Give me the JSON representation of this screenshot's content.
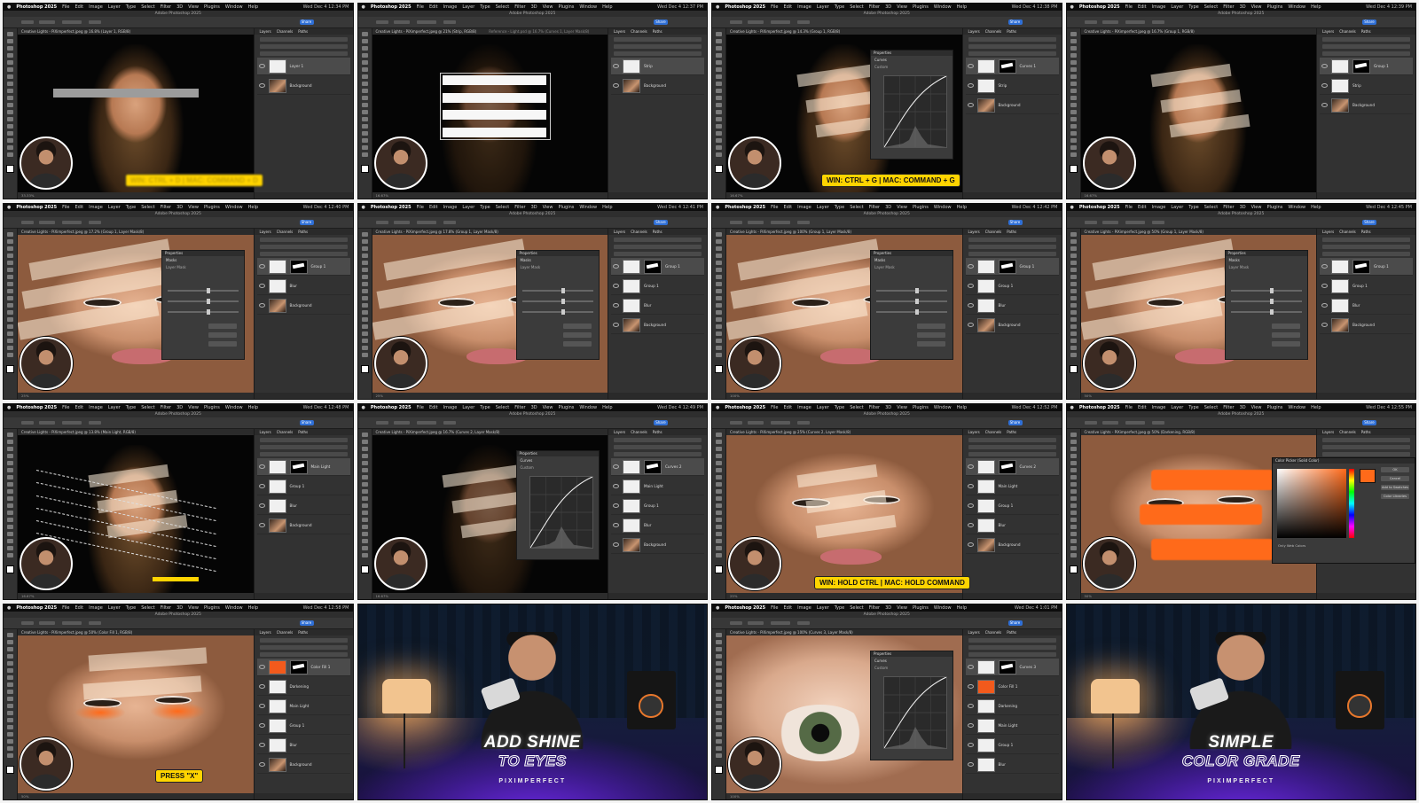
{
  "app": {
    "name": "Photoshop 2025",
    "window_title": "Adobe Photoshop 2025",
    "menus": [
      "File",
      "Edit",
      "Image",
      "Layer",
      "Type",
      "Select",
      "Filter",
      "3D",
      "View",
      "Plugins",
      "Window",
      "Help"
    ]
  },
  "frames": [
    {
      "id": "f1",
      "time": "Wed Dec 4 12:34 PM",
      "tab": "Creative Lights - PiXimperfect.jpeg @ 16.8% (Layer 1, RGB/8)",
      "scene": "stripe-single",
      "status": "33.33%",
      "layers": [
        {
          "name": "Layer 1",
          "thumb": "white",
          "sel": true
        },
        {
          "name": "Background",
          "thumb": "face"
        }
      ],
      "callout": {
        "text": "WIN: CTRL + D | MAC: COMMAND + D",
        "style": "blurred"
      }
    },
    {
      "id": "f2",
      "time": "Wed Dec 4 12:37 PM",
      "tab": "Creative Lights - PiXimperfect.jpeg @ 21% (Strip, RGB/8)",
      "tab2": "Reference - Light.psd @ 16.7% (Curves 1, Layer Mask/8)",
      "scene": "stripes-transform",
      "status": "16.67%",
      "layers": [
        {
          "name": "Strip",
          "thumb": "white",
          "sel": true
        },
        {
          "name": "Background",
          "thumb": "face"
        }
      ]
    },
    {
      "id": "f3",
      "time": "Wed Dec 4 12:38 PM",
      "tab": "Creative Lights - PiXimperfect.jpeg @ 14.3% (Group 1, RGB/8)",
      "scene": "stripes-curves",
      "status": "16.67%",
      "dialog": {
        "title": "Properties",
        "kind": "Curves",
        "preset": "Custom"
      },
      "layers": [
        {
          "name": "Curves 1",
          "thumb": "white",
          "mask": true,
          "sel": true
        },
        {
          "name": "Strip",
          "thumb": "white"
        },
        {
          "name": "Background",
          "thumb": "face"
        }
      ],
      "callout": {
        "text": "WIN: CTRL + G | MAC: COMMAND + G",
        "style": "solid"
      }
    },
    {
      "id": "f4",
      "time": "Wed Dec 4 12:39 PM",
      "tab": "Creative Lights - PiXimperfect.jpeg @ 16.7% (Group 1, RGB/8)",
      "scene": "stripes-lit",
      "status": "16.67%",
      "layers": [
        {
          "name": "Group 1",
          "thumb": "white",
          "mask": true,
          "sel": true
        },
        {
          "name": "Strip",
          "thumb": "white"
        },
        {
          "name": "Background",
          "thumb": "face"
        }
      ]
    },
    {
      "id": "f5",
      "time": "Wed Dec 4 12:40 PM",
      "tab": "Creative Lights - PiXimperfect.jpeg @ 17.2% (Group 1, Layer Mask/8)",
      "scene": "face-stripes",
      "status": "25%",
      "dialog": {
        "title": "Properties",
        "kind": "Masks",
        "preset": "Layer Mask"
      },
      "layers": [
        {
          "name": "Group 1",
          "thumb": "white",
          "mask": true,
          "sel": true
        },
        {
          "name": "Blur",
          "thumb": "white"
        },
        {
          "name": "Background",
          "thumb": "face"
        }
      ]
    },
    {
      "id": "f6",
      "time": "Wed Dec 4 12:41 PM",
      "tab": "Creative Lights - PiXimperfect.jpeg @ 17.8% (Group 1, Layer Mask/8)",
      "scene": "face-stripes",
      "status": "25%",
      "dialog": {
        "title": "Properties",
        "kind": "Masks",
        "preset": "Layer Mask"
      },
      "layers": [
        {
          "name": "Group 1",
          "thumb": "white",
          "mask": true,
          "sel": true
        },
        {
          "name": "Group 1",
          "thumb": "white"
        },
        {
          "name": "Blur",
          "thumb": "white"
        },
        {
          "name": "Background",
          "thumb": "face"
        }
      ]
    },
    {
      "id": "f7",
      "time": "Wed Dec 4 12:42 PM",
      "tab": "Creative Lights - PiXimperfect.jpeg @ 100% (Group 1, Layer Mask/8)",
      "scene": "closeup-eye",
      "status": "100%",
      "dialog": {
        "title": "Properties",
        "kind": "Masks",
        "preset": "Layer Mask"
      },
      "layers": [
        {
          "name": "Group 1",
          "thumb": "white",
          "mask": true,
          "sel": true
        },
        {
          "name": "Group 1",
          "thumb": "white"
        },
        {
          "name": "Blur",
          "thumb": "white"
        },
        {
          "name": "Background",
          "thumb": "face"
        }
      ]
    },
    {
      "id": "f8",
      "time": "Wed Dec 4 12:45 PM",
      "tab": "Creative Lights - PiXimperfect.jpeg @ 50% (Group 1, Layer Mask/8)",
      "scene": "closeup-face",
      "status": "50%",
      "dialog": {
        "title": "Properties",
        "kind": "Masks",
        "preset": "Layer Mask"
      },
      "layers": [
        {
          "name": "Group 1",
          "thumb": "white",
          "mask": true,
          "sel": true
        },
        {
          "name": "Group 1",
          "thumb": "white"
        },
        {
          "name": "Blur",
          "thumb": "white"
        },
        {
          "name": "Background",
          "thumb": "face"
        }
      ]
    },
    {
      "id": "f9",
      "time": "Wed Dec 4 12:48 PM",
      "tab": "Creative Lights - PiXimperfect.jpeg @ 13.8% (Main Light, RGB/8)",
      "scene": "stripes-selection",
      "status": "16.67%",
      "layers": [
        {
          "name": "Main Light",
          "thumb": "white",
          "mask": true,
          "sel": true
        },
        {
          "name": "Group 1",
          "thumb": "white"
        },
        {
          "name": "Blur",
          "thumb": "white"
        },
        {
          "name": "Background",
          "thumb": "face"
        }
      ],
      "bar": true
    },
    {
      "id": "f10",
      "time": "Wed Dec 4 12:49 PM",
      "tab": "Creative Lights - PiXimperfect.jpeg @ 16.7% (Curves 2, Layer Mask/8)",
      "scene": "stripes-dim-curves",
      "status": "16.67%",
      "dialog": {
        "title": "Properties",
        "kind": "Curves",
        "preset": "Custom"
      },
      "layers": [
        {
          "name": "Curves 2",
          "thumb": "white",
          "mask": true,
          "sel": true
        },
        {
          "name": "Main Light",
          "thumb": "white"
        },
        {
          "name": "Group 1",
          "thumb": "white"
        },
        {
          "name": "Blur",
          "thumb": "white"
        },
        {
          "name": "Background",
          "thumb": "face"
        }
      ]
    },
    {
      "id": "f11",
      "time": "Wed Dec 4 12:52 PM",
      "tab": "Creative Lights - PiXimperfect.jpeg @ 25% (Curves 2, Layer Mask/8)",
      "scene": "face-hair-select",
      "status": "25%",
      "layers": [
        {
          "name": "Curves 2",
          "thumb": "white",
          "mask": true,
          "sel": true
        },
        {
          "name": "Main Light",
          "thumb": "white"
        },
        {
          "name": "Group 1",
          "thumb": "white"
        },
        {
          "name": "Blur",
          "thumb": "white"
        },
        {
          "name": "Background",
          "thumb": "face"
        }
      ],
      "callout": {
        "text": "WIN: HOLD CTRL | MAC: HOLD COMMAND",
        "style": "solid"
      }
    },
    {
      "id": "f12",
      "time": "Wed Dec 4 12:55 PM",
      "tab": "Creative Lights - PiXimperfect.jpeg @ 50% (Darkening, RGB/8)",
      "scene": "orange-stripes",
      "status": "50%",
      "picker": {
        "title": "Color Picker (Solid Color)",
        "ok": "OK",
        "cancel": "Cancel",
        "add": "Add to Swatches",
        "libs": "Color Libraries",
        "web": "Only Web Colors"
      },
      "layers": [
        {
          "name": "Color Fill 1",
          "thumb": "white",
          "mask": true,
          "sel": true
        },
        {
          "name": "Darkening",
          "thumb": "white"
        },
        {
          "name": "Main Light",
          "thumb": "white"
        },
        {
          "name": "Background",
          "thumb": "face"
        }
      ]
    },
    {
      "id": "f13",
      "time": "Wed Dec 4 12:58 PM",
      "tab": "Creative Lights - PiXimperfect.jpeg @ 50% (Color Fill 1, RGB/8)",
      "scene": "orange-glow",
      "status": "50%",
      "layers": [
        {
          "name": "Color Fill 1",
          "thumb": "orange",
          "mask": true,
          "sel": true
        },
        {
          "name": "Darkening",
          "thumb": "white"
        },
        {
          "name": "Main Light",
          "thumb": "white"
        },
        {
          "name": "Group 1",
          "thumb": "white"
        },
        {
          "name": "Blur",
          "thumb": "white"
        },
        {
          "name": "Background",
          "thumb": "face"
        }
      ],
      "callout": {
        "text": "PRESS \"X\"",
        "style": "solid"
      }
    },
    {
      "id": "f14",
      "scene": "title-card",
      "card": {
        "line1": "ADD SHINE",
        "line2": "TO EYES",
        "brand": "PIXIMPERFECT"
      }
    },
    {
      "id": "f15",
      "time": "Wed Dec 4 1:01 PM",
      "tab": "Creative Lights - PiXimperfect.jpeg @ 100% (Curves 3, Layer Mask/8)",
      "scene": "eye-macro",
      "status": "100%",
      "dialog": {
        "title": "Properties",
        "kind": "Curves",
        "preset": "Custom"
      },
      "layers": [
        {
          "name": "Curves 3",
          "thumb": "white",
          "mask": true,
          "sel": true
        },
        {
          "name": "Color Fill 1",
          "thumb": "orange"
        },
        {
          "name": "Darkening",
          "thumb": "white"
        },
        {
          "name": "Main Light",
          "thumb": "white"
        },
        {
          "name": "Group 1",
          "thumb": "white"
        },
        {
          "name": "Blur",
          "thumb": "white"
        }
      ]
    },
    {
      "id": "f16",
      "scene": "title-card",
      "card": {
        "line1": "SIMPLE",
        "line2": "COLOR GRADE",
        "brand": "PIXIMPERFECT"
      }
    }
  ],
  "panel": {
    "tabs": [
      "Layers",
      "Channels",
      "Paths"
    ]
  },
  "colors": {
    "accent": "#ffd400",
    "orange": "#ff6a1a",
    "ui": "#323232"
  }
}
